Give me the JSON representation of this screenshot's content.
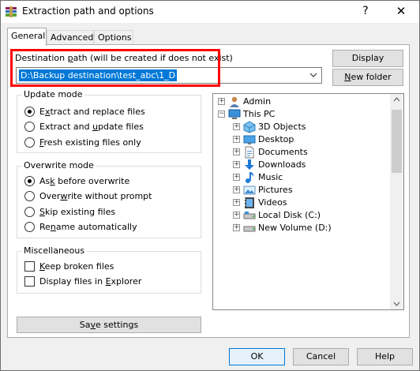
{
  "window": {
    "title": "Extraction path and options",
    "help_glyph": "?",
    "close_glyph": "✕"
  },
  "tabs": [
    {
      "label": "General",
      "active": true
    },
    {
      "label": "Advanced",
      "active": false
    },
    {
      "label": "Options",
      "active": false
    }
  ],
  "destination": {
    "label_pre": "Destination ",
    "label_key": "p",
    "label_post": "ath (will be created if does not exist)",
    "path": "D:\\Backup destination\\test_abc\\1_D",
    "display_button": "Display",
    "new_folder_pre": "",
    "new_folder_key": "N",
    "new_folder_post": "ew folder"
  },
  "update_mode": {
    "title": "Update mode",
    "options": [
      {
        "pre": "E",
        "key": "x",
        "post": "tract and replace files",
        "selected": true
      },
      {
        "pre": "Extract and ",
        "key": "u",
        "post": "pdate files",
        "selected": false
      },
      {
        "pre": "",
        "key": "F",
        "post": "resh existing files only",
        "selected": false
      }
    ]
  },
  "overwrite_mode": {
    "title": "Overwrite mode",
    "options": [
      {
        "pre": "As",
        "key": "k",
        "post": " before overwrite",
        "selected": true
      },
      {
        "pre": "Over",
        "key": "w",
        "post": "rite without prompt",
        "selected": false
      },
      {
        "pre": "",
        "key": "S",
        "post": "kip existing files",
        "selected": false
      },
      {
        "pre": "Re",
        "key": "n",
        "post": "ame automatically",
        "selected": false
      }
    ]
  },
  "misc": {
    "title": "Miscellaneous",
    "options": [
      {
        "pre": "",
        "key": "K",
        "post": "eep broken files",
        "checked": false
      },
      {
        "pre": "Display files in ",
        "key": "E",
        "post": "xplorer",
        "checked": false
      }
    ]
  },
  "save_settings": {
    "pre": "Sa",
    "key": "v",
    "post": "e settings"
  },
  "tree": {
    "items": [
      {
        "label": "Admin",
        "icon": "user-icon",
        "level": 0,
        "expander": "+"
      },
      {
        "label": "This PC",
        "icon": "computer-icon",
        "level": 0,
        "expander": "−"
      },
      {
        "label": "3D Objects",
        "icon": "3d-objects-icon",
        "level": 1,
        "expander": "+"
      },
      {
        "label": "Desktop",
        "icon": "desktop-icon",
        "level": 1,
        "expander": "+"
      },
      {
        "label": "Documents",
        "icon": "documents-icon",
        "level": 1,
        "expander": "+"
      },
      {
        "label": "Downloads",
        "icon": "downloads-icon",
        "level": 1,
        "expander": "+"
      },
      {
        "label": "Music",
        "icon": "music-icon",
        "level": 1,
        "expander": "+"
      },
      {
        "label": "Pictures",
        "icon": "pictures-icon",
        "level": 1,
        "expander": "+"
      },
      {
        "label": "Videos",
        "icon": "videos-icon",
        "level": 1,
        "expander": "+"
      },
      {
        "label": "Local Disk (C:)",
        "icon": "local-disk-icon",
        "level": 1,
        "expander": "+"
      },
      {
        "label": "New Volume (D:)",
        "icon": "drive-icon",
        "level": 1,
        "expander": "+"
      }
    ]
  },
  "footer": {
    "ok": "OK",
    "cancel": "Cancel",
    "help": "Help"
  },
  "colors": {
    "selection": "#0078d7",
    "highlight_box": "#ff0000",
    "dialog_bg": "#f0f0f0"
  }
}
